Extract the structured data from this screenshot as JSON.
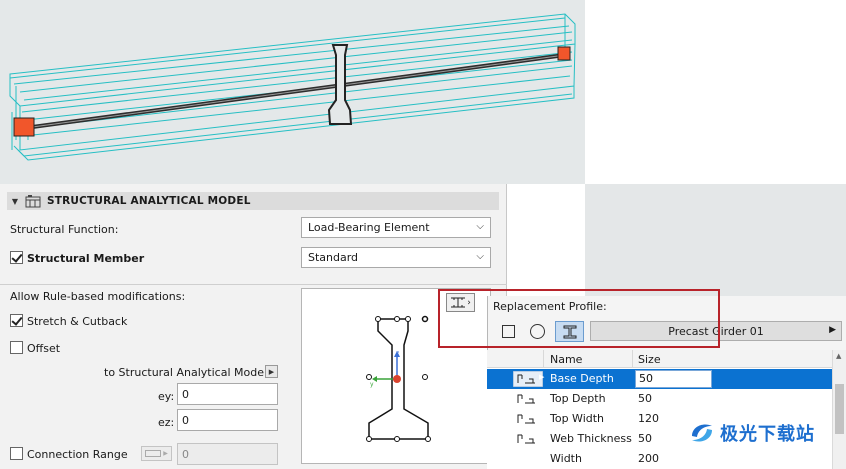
{
  "viewport": {
    "colors": {
      "background": "#e4e8e9",
      "girder_outline": "#26bfc4",
      "node": "#f1562b",
      "member_line": "#2d2d2d"
    }
  },
  "panel": {
    "title": "STRUCTURAL ANALYTICAL MODEL",
    "structural_function_label": "Structural Function:",
    "structural_function_value": "Load-Bearing Element",
    "structural_member_label": "Structural Member",
    "structural_member_checked": true,
    "structural_member_value": "Standard",
    "allow_rule_label": "Allow Rule-based modifications:",
    "stretch_label": "Stretch & Cutback",
    "stretch_checked": true,
    "offset_label": "Offset",
    "offset_checked": false,
    "to_sam_label": "to Structural Analytical Model",
    "ey_label": "ey:",
    "ey_value": "0",
    "ez_label": "ez:",
    "ez_value": "0",
    "connection_range_label": "Connection Range",
    "connection_range_checked": false,
    "connection_range_value": "0"
  },
  "replacement": {
    "title": "Replacement Profile:",
    "shapes": [
      "rectangle-icon",
      "circle-icon",
      "i-profile-icon"
    ],
    "active_shape": "i-profile-icon",
    "profile_value": "Precast Girder 01",
    "columns": {
      "name": "Name",
      "size": "Size"
    },
    "rows": [
      {
        "name": "Base Depth",
        "size": "50",
        "selected": true
      },
      {
        "name": "Top Depth",
        "size": "50",
        "selected": false
      },
      {
        "name": "Top Width",
        "size": "120",
        "selected": false
      },
      {
        "name": "Web Thickness",
        "size": "50",
        "selected": false
      },
      {
        "name": "Width",
        "size": "200",
        "selected": false
      }
    ],
    "highlight_color": "#b8232a",
    "selection_color": "#0b72d1"
  },
  "watermark": {
    "text": "极光下载站"
  }
}
